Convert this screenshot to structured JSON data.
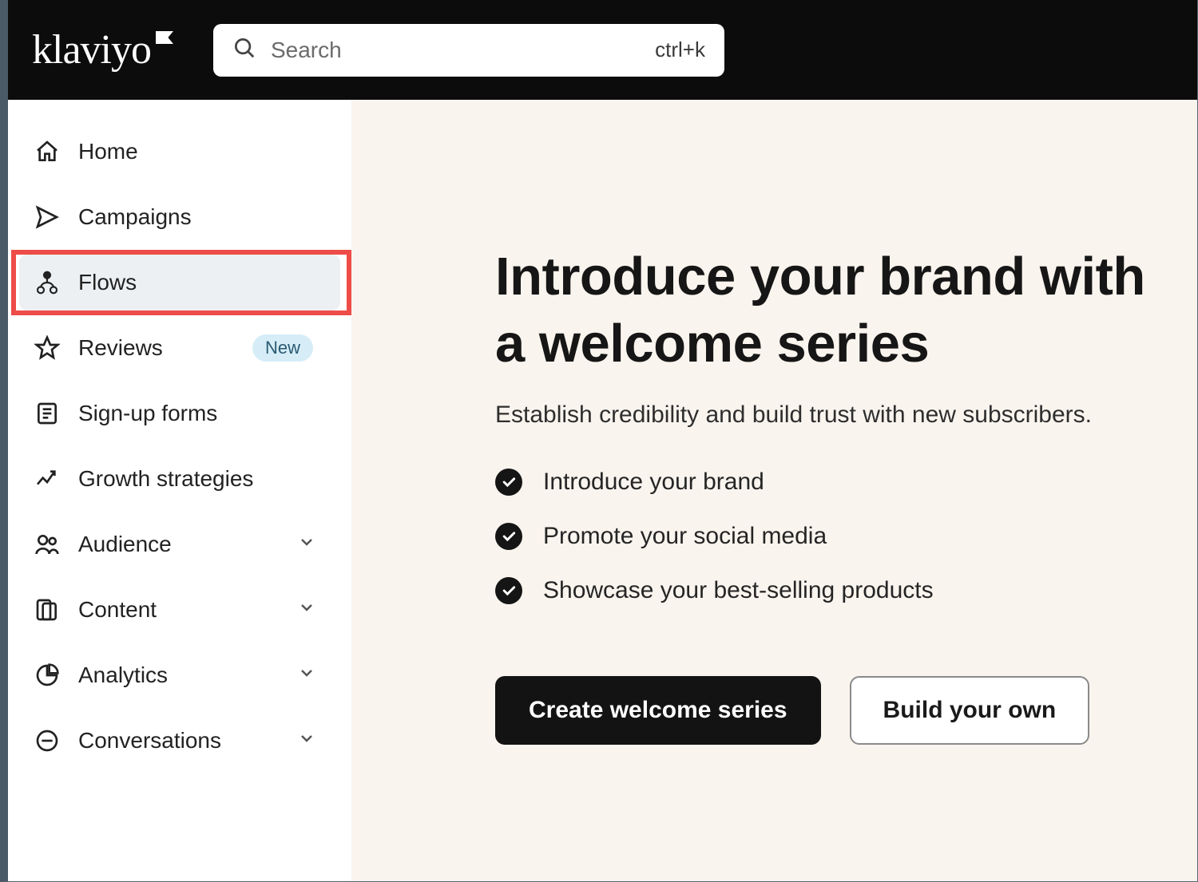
{
  "header": {
    "logo_text": "klaviyo",
    "search_placeholder": "Search",
    "search_shortcut": "ctrl+k"
  },
  "sidebar": {
    "items": [
      {
        "label": "Home",
        "icon": "home-icon"
      },
      {
        "label": "Campaigns",
        "icon": "send-icon"
      },
      {
        "label": "Flows",
        "icon": "flows-icon",
        "active": true,
        "highlight": true
      },
      {
        "label": "Reviews",
        "icon": "star-icon",
        "badge": "New"
      },
      {
        "label": "Sign-up forms",
        "icon": "form-icon"
      },
      {
        "label": "Growth strategies",
        "icon": "trend-icon"
      },
      {
        "label": "Audience",
        "icon": "people-icon",
        "expandable": true
      },
      {
        "label": "Content",
        "icon": "content-icon",
        "expandable": true
      },
      {
        "label": "Analytics",
        "icon": "pie-icon",
        "expandable": true
      },
      {
        "label": "Conversations",
        "icon": "chat-icon",
        "expandable": true
      }
    ]
  },
  "main": {
    "title": "Introduce your brand with a welcome series",
    "subtitle": "Establish credibility and build trust with new subscribers.",
    "checks": [
      "Introduce your brand",
      "Promote your social media",
      "Showcase your best-selling products"
    ],
    "primary_button": "Create welcome series",
    "secondary_button": "Build your own"
  }
}
